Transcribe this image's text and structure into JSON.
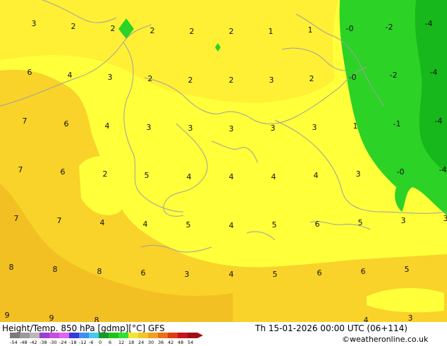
{
  "map": {
    "colors": {
      "bright_yellow": "#ffff3a",
      "light_yellow": "#fff035",
      "gold": "#f9d22a",
      "deep_gold": "#f2c022",
      "green": "#2cd226",
      "dark_green": "#17b81b",
      "coastline": "#a0a0a0"
    },
    "labels": [
      {
        "text": "3",
        "col": 48,
        "row": 34
      },
      {
        "text": "2",
        "col": 104,
        "row": 38
      },
      {
        "text": "2",
        "col": 160,
        "row": 41
      },
      {
        "text": "2",
        "col": 216,
        "row": 44
      },
      {
        "text": "2",
        "col": 272,
        "row": 45
      },
      {
        "text": "2",
        "col": 328,
        "row": 45
      },
      {
        "text": "1",
        "col": 384,
        "row": 45
      },
      {
        "text": "1",
        "col": 440,
        "row": 43
      },
      {
        "text": "-0",
        "col": 496,
        "row": 41
      },
      {
        "text": "-2",
        "col": 552,
        "row": 39
      },
      {
        "text": "-4",
        "col": 608,
        "row": 34
      },
      {
        "text": "6",
        "col": 42,
        "row": 103
      },
      {
        "text": "4",
        "col": 99,
        "row": 107
      },
      {
        "text": "3",
        "col": 156,
        "row": 110
      },
      {
        "text": "2",
        "col": 213,
        "row": 112
      },
      {
        "text": "2",
        "col": 270,
        "row": 114
      },
      {
        "text": "2",
        "col": 328,
        "row": 114
      },
      {
        "text": "3",
        "col": 385,
        "row": 114
      },
      {
        "text": "2",
        "col": 442,
        "row": 112
      },
      {
        "text": "-0",
        "col": 500,
        "row": 110
      },
      {
        "text": "-2",
        "col": 558,
        "row": 107
      },
      {
        "text": "-4",
        "col": 615,
        "row": 103
      },
      {
        "text": "7",
        "col": 35,
        "row": 172
      },
      {
        "text": "6",
        "col": 94,
        "row": 176
      },
      {
        "text": "4",
        "col": 152,
        "row": 179
      },
      {
        "text": "3",
        "col": 211,
        "row": 181
      },
      {
        "text": "3",
        "col": 270,
        "row": 182
      },
      {
        "text": "3",
        "col": 328,
        "row": 183
      },
      {
        "text": "3",
        "col": 387,
        "row": 182
      },
      {
        "text": "3",
        "col": 446,
        "row": 181
      },
      {
        "text": "1",
        "col": 504,
        "row": 179
      },
      {
        "text": "-1",
        "col": 563,
        "row": 176
      },
      {
        "text": "-4",
        "col": 622,
        "row": 172
      },
      {
        "text": "7",
        "col": 29,
        "row": 241
      },
      {
        "text": "6",
        "col": 89,
        "row": 244
      },
      {
        "text": "2",
        "col": 149,
        "row": 247
      },
      {
        "text": "5",
        "col": 208,
        "row": 249
      },
      {
        "text": "4",
        "col": 268,
        "row": 251
      },
      {
        "text": "4",
        "col": 328,
        "row": 251
      },
      {
        "text": "4",
        "col": 388,
        "row": 251
      },
      {
        "text": "4",
        "col": 448,
        "row": 249
      },
      {
        "text": "3",
        "col": 508,
        "row": 247
      },
      {
        "text": "-0",
        "col": 568,
        "row": 244
      },
      {
        "text": "-4",
        "col": 628,
        "row": 241
      },
      {
        "text": "7",
        "col": 23,
        "row": 310
      },
      {
        "text": "7",
        "col": 84,
        "row": 313
      },
      {
        "text": "4",
        "col": 145,
        "row": 316
      },
      {
        "text": "4",
        "col": 206,
        "row": 318
      },
      {
        "text": "5",
        "col": 267,
        "row": 319
      },
      {
        "text": "4",
        "col": 328,
        "row": 320
      },
      {
        "text": "5",
        "col": 389,
        "row": 319
      },
      {
        "text": "6",
        "col": 450,
        "row": 318
      },
      {
        "text": "5",
        "col": 511,
        "row": 316
      },
      {
        "text": "3",
        "col": 572,
        "row": 313
      },
      {
        "text": "3",
        "col": 632,
        "row": 310
      },
      {
        "text": "8",
        "col": 16,
        "row": 379
      },
      {
        "text": "8",
        "col": 78,
        "row": 382
      },
      {
        "text": "8",
        "col": 141,
        "row": 385
      },
      {
        "text": "6",
        "col": 203,
        "row": 387
      },
      {
        "text": "3",
        "col": 265,
        "row": 389
      },
      {
        "text": "4",
        "col": 328,
        "row": 389
      },
      {
        "text": "5",
        "col": 390,
        "row": 389
      },
      {
        "text": "6",
        "col": 453,
        "row": 387
      },
      {
        "text": "6",
        "col": 515,
        "row": 385
      },
      {
        "text": "5",
        "col": 577,
        "row": 382
      },
      {
        "text": "9",
        "col": 10,
        "row": 447
      },
      {
        "text": "9",
        "col": 73,
        "row": 451
      },
      {
        "text": "8",
        "col": 137,
        "row": 454
      },
      {
        "text": "4",
        "col": 519,
        "row": 454
      },
      {
        "text": "3",
        "col": 582,
        "row": 451
      }
    ]
  },
  "footer": {
    "title": "Height/Temp. 850 hPa [gdmp][°C] GFS",
    "datetime": "Th 15-01-2026 00:00 UTC (06+114)",
    "credit": "©weatheronline.co.uk",
    "scale": {
      "labels": [
        "-54",
        "-48",
        "-42",
        "-38",
        "-30",
        "-24",
        "-18",
        "-12",
        "-6",
        "0",
        "6",
        "12",
        "18",
        "24",
        "30",
        "36",
        "42",
        "48",
        "54"
      ],
      "colors": [
        "#7a7a7a",
        "#9a9a9a",
        "#b8b8b8",
        "#9b3fd0",
        "#c24ee0",
        "#e064f0",
        "#3a3adb",
        "#3f8ff0",
        "#46c8f0",
        "#139a2b",
        "#1ec31e",
        "#2ee22e",
        "#f0e630",
        "#f5c428",
        "#f0a01e",
        "#e87018",
        "#e43a14",
        "#c8141e",
        "#a01010"
      ]
    }
  }
}
